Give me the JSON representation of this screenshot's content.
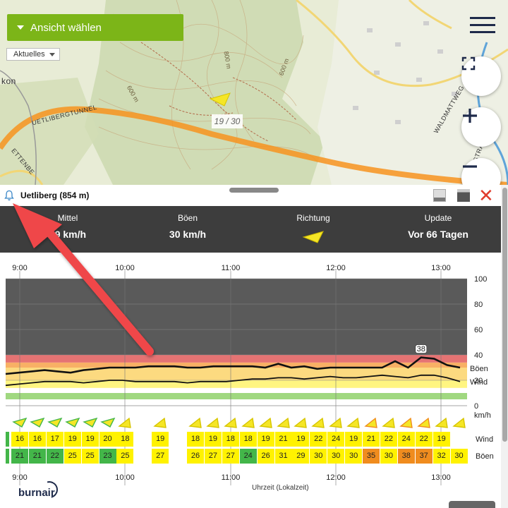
{
  "map": {
    "view_button_label": "Ansicht wählen",
    "layer_select_value": "Aktuelles",
    "marker_label": "19 / 30",
    "labels": [
      "800 m",
      "600 m",
      "600 m",
      "UETLIBERGTUNNEL",
      "WALDMATTWEG",
      "kon",
      "ETTENBE",
      "OSTRA"
    ]
  },
  "panel": {
    "station_name": "Uetliberg (854 m)",
    "stats": [
      {
        "label": "Mittel",
        "value": "19 km/h"
      },
      {
        "label": "Böen",
        "value": "30 km/h"
      },
      {
        "label": "Richtung",
        "value": ""
      },
      {
        "label": "Update",
        "value": "Vor 66 Tagen"
      }
    ]
  },
  "chart_data": {
    "type": "line",
    "x_tick_labels": [
      "9:00",
      "10:00",
      "11:00",
      "12:00",
      "13:00"
    ],
    "y_tick_labels": [
      "100",
      "80",
      "60",
      "40",
      "20",
      "0"
    ],
    "y_unit": "km/h",
    "ylim": [
      0,
      100
    ],
    "xlabel": "Uhrzeit (Lokalzeit)",
    "peak_label": "38",
    "series": [
      {
        "name": "Böen",
        "values": [
          25,
          26,
          27,
          28,
          27,
          26,
          28,
          29,
          30,
          30,
          30,
          31,
          31,
          31,
          30,
          30,
          31,
          31,
          31,
          31,
          30,
          33,
          30,
          31,
          29,
          30,
          30,
          30,
          30,
          30,
          35,
          30,
          38,
          37,
          32,
          30
        ]
      },
      {
        "name": "Wind",
        "values": [
          16,
          17,
          18,
          19,
          19,
          19,
          18,
          19,
          20,
          20,
          19,
          19,
          19,
          19,
          18,
          19,
          19,
          19,
          20,
          21,
          21,
          22,
          22,
          21,
          22,
          23,
          22,
          22,
          23,
          24,
          23,
          22,
          24,
          24,
          22,
          19
        ]
      },
      {
        "name": "bands",
        "values": [
          0,
          10,
          14,
          20,
          30,
          34,
          40
        ]
      }
    ]
  },
  "table": {
    "wind_label": "Wind",
    "gust_label": "Böen",
    "wind": [
      "16",
      "16",
      "17",
      "19",
      "19",
      "20",
      "18",
      "",
      "19",
      "",
      "18",
      "19",
      "18",
      "18",
      "19",
      "21",
      "19",
      "22",
      "24",
      "19",
      "21",
      "22",
      "24",
      "22",
      "19"
    ],
    "gust": [
      "21",
      "21",
      "22",
      "25",
      "25",
      "23",
      "25",
      "",
      "27",
      "",
      "26",
      "27",
      "27",
      "24",
      "26",
      "31",
      "29",
      "30",
      "30",
      "30",
      "35",
      "30",
      "38",
      "37",
      "32",
      "30"
    ],
    "gust_colors": [
      "#43b649",
      "#43b649",
      "#43b649",
      "#fff200",
      "#fff200",
      "#43b649",
      "#fff200",
      "",
      "#fff200",
      "",
      "#fff200",
      "#fff200",
      "#fff200",
      "#43b649",
      "#fff200",
      "#fff200",
      "#fff200",
      "#fff200",
      "#fff200",
      "#fff200",
      "#f08c1e",
      "#fff200",
      "#f08c1e",
      "#f08c1e",
      "#fff200",
      "#fff200"
    ],
    "wind_colors": [
      "#fff200",
      "#fff200",
      "#fff200",
      "#fff200",
      "#fff200",
      "#fff200",
      "#fff200",
      "",
      "#fff200",
      "",
      "#fff200",
      "#fff200",
      "#fff200",
      "#fff200",
      "#fff200",
      "#fff200",
      "#fff200",
      "#fff200",
      "#fff200",
      "#fff200",
      "#fff200",
      "#fff200",
      "#fff200",
      "#fff200",
      "#fff200"
    ]
  },
  "brand": "burnair"
}
